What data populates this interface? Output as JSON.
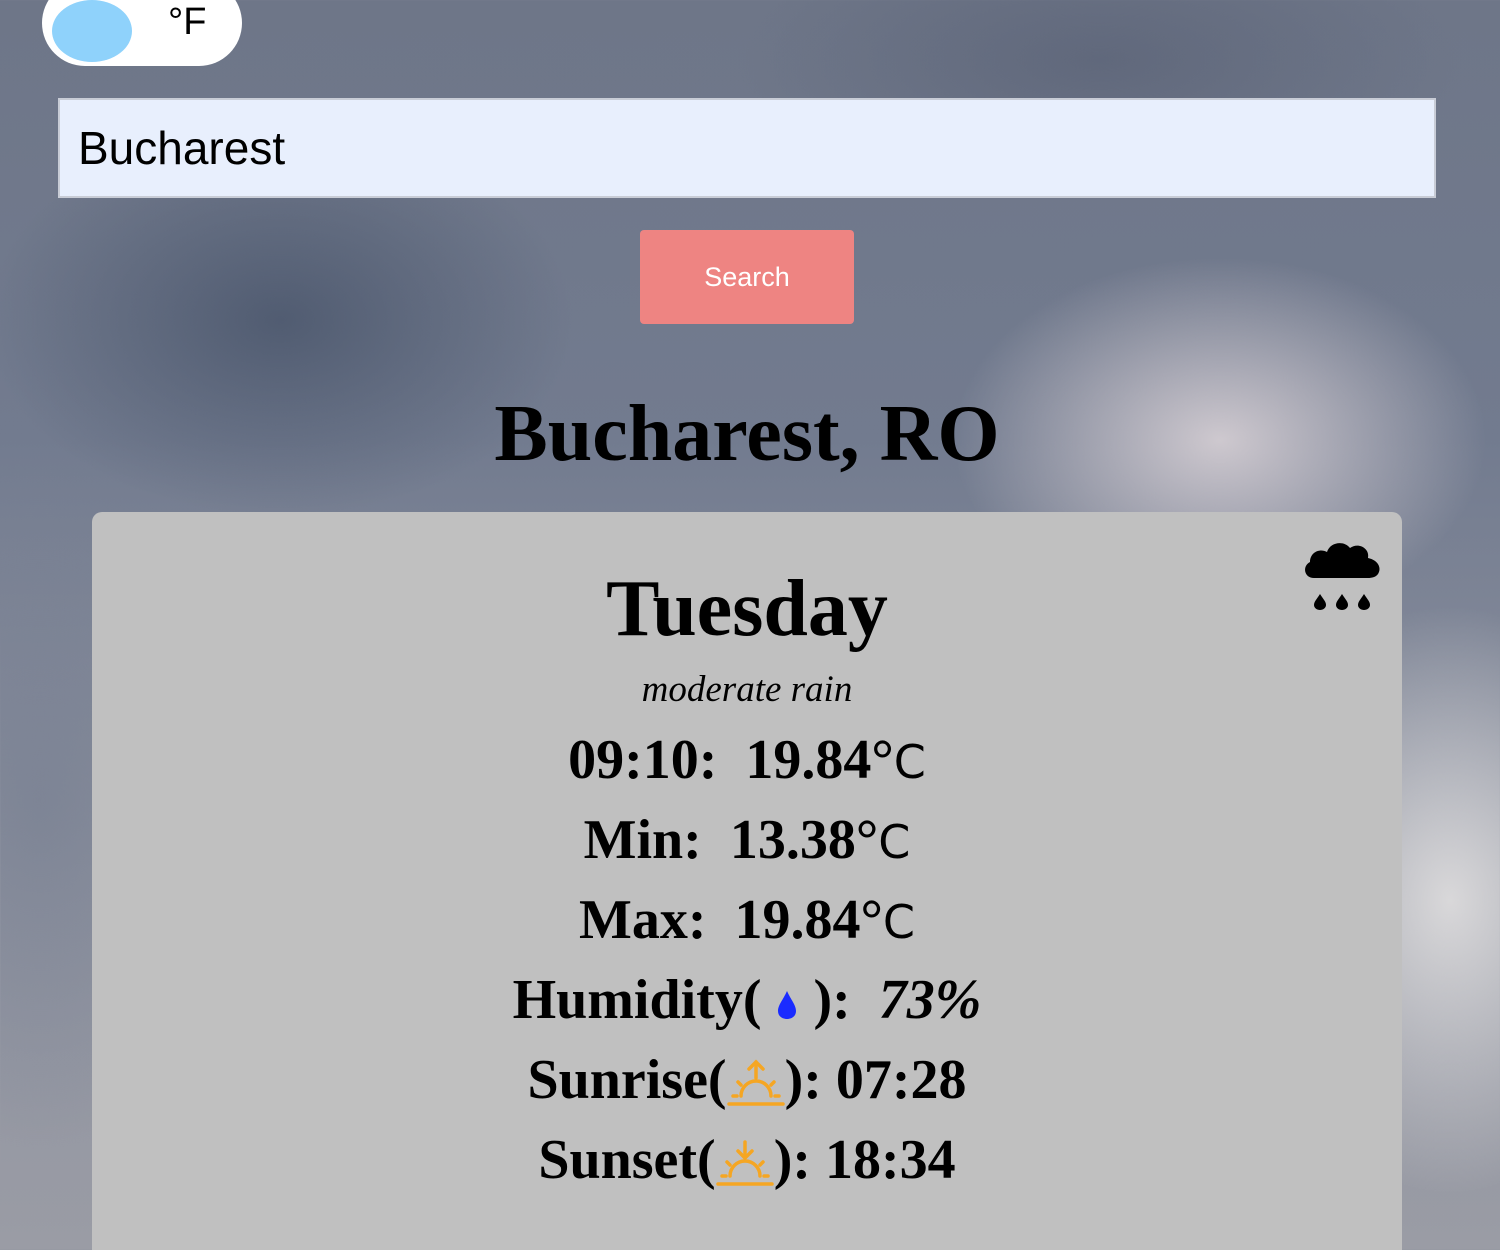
{
  "unit_toggle": {
    "label": "°F",
    "knob_color": "#8fd2fb"
  },
  "search": {
    "value": "Bucharest",
    "button_label": "Search",
    "button_color": "#ee8482"
  },
  "location": {
    "title": "Bucharest, RO"
  },
  "forecast": {
    "day": "Tuesday",
    "description": "moderate rain",
    "condition_icon": "cloud-rain-icon",
    "current": {
      "time": "09:10:",
      "temp": "19.84°",
      "unit": "C"
    },
    "min": {
      "label": "Min:",
      "temp": "13.38°",
      "unit": "C"
    },
    "max": {
      "label": "Max:",
      "temp": "19.84°",
      "unit": "C"
    },
    "humidity": {
      "label_open": "Humidity(",
      "label_close": "):",
      "value": "73%",
      "icon": "droplet-icon",
      "icon_color": "#1a2bff"
    },
    "sunrise": {
      "label_open": "Sunrise(",
      "label_close": "):",
      "time": "07:28",
      "icon": "sunrise-icon",
      "icon_color": "#f5a623"
    },
    "sunset": {
      "label_open": "Sunset(",
      "label_close": "):",
      "time": "18:34",
      "icon": "sunset-icon",
      "icon_color": "#f5a623"
    }
  }
}
